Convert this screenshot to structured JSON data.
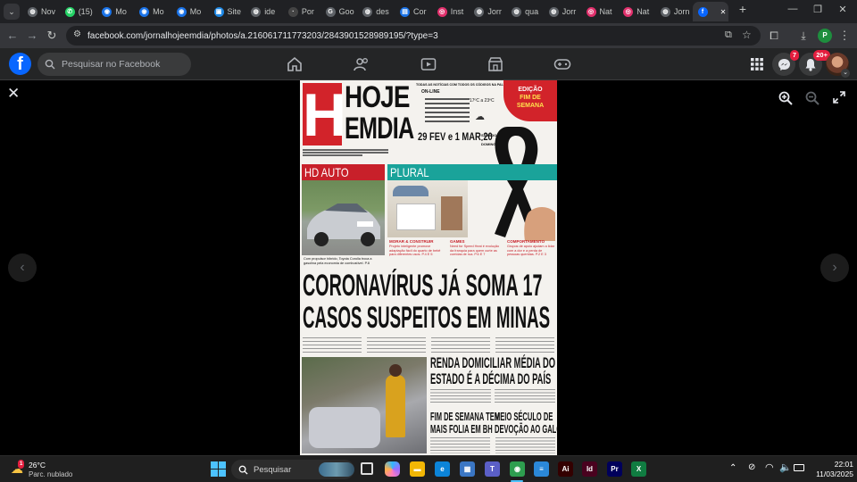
{
  "tabs": [
    {
      "label": "Nov",
      "color": "#5f6368",
      "glyph": "◍"
    },
    {
      "label": "(15)",
      "color": "#25d366",
      "glyph": "✆"
    },
    {
      "label": "Mo",
      "color": "#1a73e8",
      "glyph": "◉"
    },
    {
      "label": "Mo",
      "color": "#1a73e8",
      "glyph": "◉"
    },
    {
      "label": "Mo",
      "color": "#1a73e8",
      "glyph": "◉"
    },
    {
      "label": "Site",
      "color": "#1e88e5",
      "glyph": "▣"
    },
    {
      "label": "ide",
      "color": "#5f6368",
      "glyph": "◍"
    },
    {
      "label": "Por",
      "color": "#444",
      "glyph": "·"
    },
    {
      "label": "Goo",
      "color": "#5f6368",
      "glyph": "G"
    },
    {
      "label": "des",
      "color": "#5f6368",
      "glyph": "◍"
    },
    {
      "label": "Cor",
      "color": "#1a73e8",
      "glyph": "▤"
    },
    {
      "label": "Inst",
      "color": "#e1306c",
      "glyph": "◎"
    },
    {
      "label": "Jorr",
      "color": "#5f6368",
      "glyph": "◍"
    },
    {
      "label": "qua",
      "color": "#5f6368",
      "glyph": "◍"
    },
    {
      "label": "Jorr",
      "color": "#5f6368",
      "glyph": "◍"
    },
    {
      "label": "Nat",
      "color": "#e1306c",
      "glyph": "◎"
    },
    {
      "label": "Nat",
      "color": "#e1306c",
      "glyph": "◎"
    },
    {
      "label": "Jorn",
      "color": "#5f6368",
      "glyph": "◍"
    },
    {
      "label": "",
      "color": "#0866ff",
      "glyph": "f"
    }
  ],
  "browser": {
    "url": "facebook.com/jornalhojeemdia/photos/a.216061711773203/2843901528989195/?type=3",
    "new_tab": "+",
    "minimize": "—",
    "maximize": "❐",
    "close": "✕",
    "tab_close": "✕"
  },
  "facebook": {
    "logo": "f",
    "search_placeholder": "Pesquisar no Facebook",
    "messenger_badge": "7",
    "notifications_badge": "20+"
  },
  "paper": {
    "logo_letter": "H",
    "masthead_line1": "HOJE",
    "masthead_line2": "EMDIA",
    "edition_line1": "EDIÇÃO",
    "edition_line2": "FIM DE",
    "edition_line3": "SEMANA",
    "top_note": "TODAS AS NOTÍCIAS COM TODOS OS CÓDIGOS NA PALMA DA SUA MÃO",
    "online_label": "ON-LINE",
    "date": "29 FEV e 1 MAR 20",
    "date_side": "SÁBADO e DOMINGO",
    "weather": "17ºC a 23ºC",
    "section_auto": "HD AUTO",
    "section_plural": "PLURAL",
    "auto_caption": "Com propulsor híbrido, Toyota Corolla troca a gasolina pela economia de combustível. P.8",
    "plural_col1_title": "MORAR & CONSTRUIR",
    "plural_col1_text": "Projeto inteligente promove adaptação fácil do quarto de bebê para diferentes usos. P.4 E 5",
    "plural_col2_title": "GAMES",
    "plural_col2_text": "Need for Speed Heat é evolução da franquia para quem curte as corridas de rua. P.6 E 7",
    "plural_col3_title": "COMPORTAMENTO",
    "plural_col3_text": "Grupos de apoio ajudam a lidar com a dor e a perda de pessoas queridas. P.2 E 3",
    "headline_line1": "CORONAVÍRUS JÁ SOMA 17",
    "headline_line2": "CASOS SUSPEITOS EM MINAS",
    "story2_line1": "RENDA DOMICILIAR MÉDIA DO",
    "story2_line2": "ESTADO É A DÉCIMA DO PAÍS",
    "story3_line1": "FIM DE SEMANA TEM",
    "story3_line2": "MAIS FOLIA EM BH",
    "story4_line1": "MEIO SÉCULO DE",
    "story4_line2": "DEVOÇÃO AO GALO"
  },
  "taskbar": {
    "weather_temp": "26°C",
    "weather_desc": "Parc. nublado",
    "weather_badge": "1",
    "search_placeholder": "Pesquisar",
    "time": "22:01",
    "date": "11/03/2025",
    "apps": [
      {
        "name": "files-icon",
        "color": "#f2b705",
        "label": "▬"
      },
      {
        "name": "edge-icon",
        "color": "#0c84d8",
        "label": "e"
      },
      {
        "name": "store-icon",
        "color": "#3a76c4",
        "label": "▦"
      },
      {
        "name": "teams-icon",
        "color": "#5b5fc7",
        "label": "T"
      },
      {
        "name": "chrome-icon",
        "color": "#2e9e4f",
        "label": "◉"
      },
      {
        "name": "notepad-icon",
        "color": "#2b88d8",
        "label": "≡"
      },
      {
        "name": "illustrator-icon",
        "color": "#330000",
        "label": "Ai"
      },
      {
        "name": "indesign-icon",
        "color": "#49021f",
        "label": "Id"
      },
      {
        "name": "premiere-icon",
        "color": "#00005b",
        "label": "Pr"
      },
      {
        "name": "excel-icon",
        "color": "#107c41",
        "label": "X"
      }
    ]
  }
}
